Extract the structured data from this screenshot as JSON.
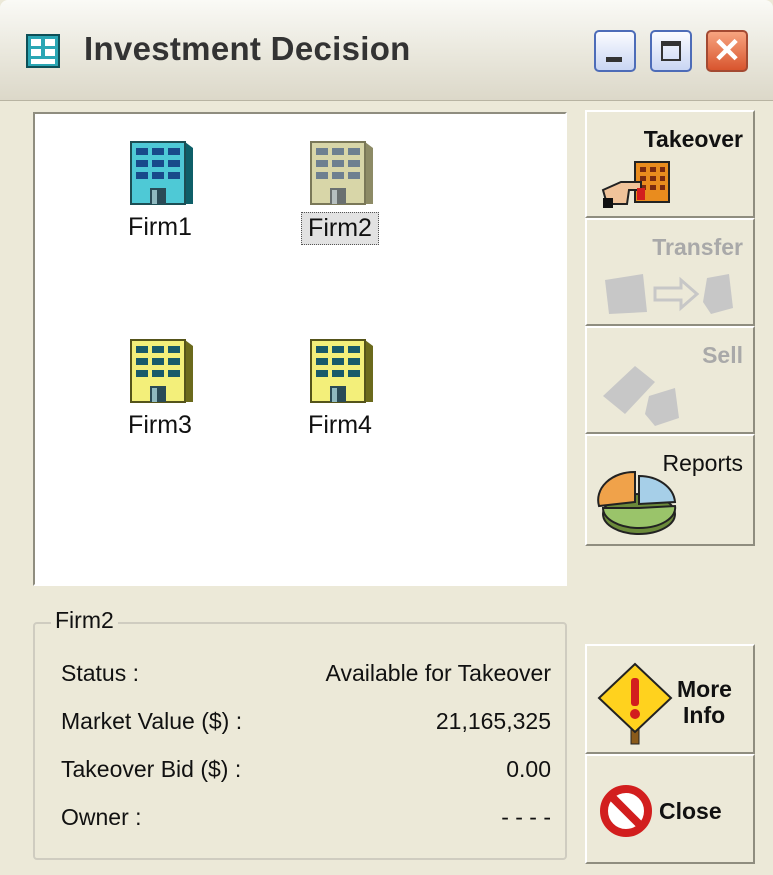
{
  "window": {
    "title": "Investment Decision",
    "controls": {
      "minimize": "_",
      "maximize": "□",
      "close": "✕"
    }
  },
  "firms": [
    {
      "name": "Firm1",
      "color": "#4ec9d6",
      "selected": false
    },
    {
      "name": "Firm2",
      "color": "#d8d6a8",
      "selected": true
    },
    {
      "name": "Firm3",
      "color": "#f3ef7a",
      "selected": false
    },
    {
      "name": "Firm4",
      "color": "#f3ef7a",
      "selected": false
    }
  ],
  "toolbar": {
    "takeover": {
      "label": "Takeover",
      "enabled": true
    },
    "transfer": {
      "label": "Transfer",
      "enabled": false
    },
    "sell": {
      "label": "Sell",
      "enabled": false
    },
    "reports": {
      "label": "Reports",
      "enabled": true
    }
  },
  "details": {
    "group_title": "Firm2",
    "rows": [
      {
        "label": "Status :",
        "value": "Available for Takeover"
      },
      {
        "label": "Market Value ($) :",
        "value": "21,165,325"
      },
      {
        "label": "Takeover Bid ($) :",
        "value": "0.00"
      },
      {
        "label": "Owner :",
        "value": "- - - -"
      }
    ]
  },
  "buttons": {
    "more_info": {
      "line1": "More",
      "line2": "Info"
    },
    "close": {
      "label": "Close"
    }
  },
  "icons": {
    "app": "building-grid-icon",
    "takeover": "hand-building-icon",
    "transfer": "transfer-arrow-icon",
    "sell": "sell-shapes-icon",
    "reports": "pie-chart-icon",
    "more_info": "warning-sign-icon",
    "close": "no-entry-icon"
  }
}
